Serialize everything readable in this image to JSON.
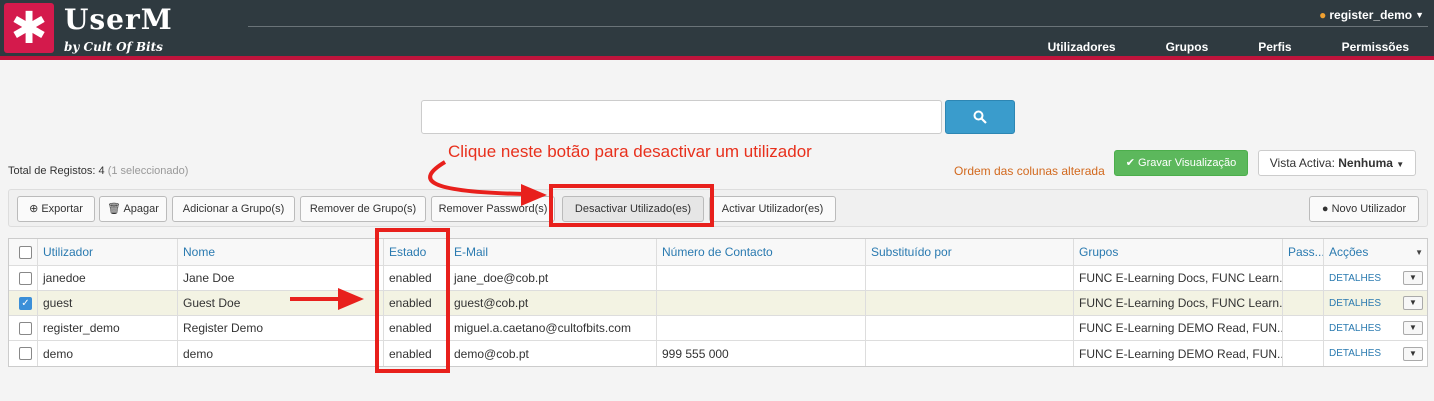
{
  "header": {
    "logo_glyph": "✱",
    "title": "UserM",
    "subtitle": "by Cult Of Bits",
    "user": "register_demo",
    "nav": [
      "Utilizadores",
      "Grupos",
      "Perfis",
      "Permissões"
    ]
  },
  "search": {
    "placeholder": ""
  },
  "summary": {
    "total_label": "Total de Registos:",
    "total_count": "4",
    "selected": "(1 seleccionado)",
    "column_note": "Ordem das colunas alterada",
    "save_view": "Gravar Visualização",
    "active_view_label": "Vista Activa:",
    "active_view_value": "Nenhuma"
  },
  "annotation": "Clique neste botão para desactivar um utilizador",
  "toolbar": {
    "export": "Exportar",
    "delete": "Apagar",
    "add_group": "Adicionar a Grupo(s)",
    "remove_group": "Remover de Grupo(s)",
    "remove_password": "Remover Password(s)",
    "deactivate": "Desactivar Utilizado(es)",
    "activate": "Activar Utilizador(es)",
    "new_user": "Novo Utilizador"
  },
  "table": {
    "headers": [
      "Utilizador",
      "Nome",
      "Estado",
      "E-Mail",
      "Número de Contacto",
      "Substituído por",
      "Grupos",
      "Pass...",
      "Acções"
    ],
    "action_label": "DETALHES",
    "rows": [
      {
        "user": "janedoe",
        "name": "Jane Doe",
        "state": "enabled",
        "email": "jane_doe@cob.pt",
        "phone": "",
        "replaced": "",
        "groups": "FUNC E-Learning Docs, FUNC Learn...",
        "checked": false
      },
      {
        "user": "guest",
        "name": "Guest Doe",
        "state": "enabled",
        "email": "guest@cob.pt",
        "phone": "",
        "replaced": "",
        "groups": "FUNC E-Learning Docs, FUNC Learn...",
        "checked": true
      },
      {
        "user": "register_demo",
        "name": "Register Demo",
        "state": "enabled",
        "email": "miguel.a.caetano@cultofbits.com",
        "phone": "",
        "replaced": "",
        "groups": "FUNC E-Learning DEMO Read, FUN...",
        "checked": false
      },
      {
        "user": "demo",
        "name": "demo",
        "state": "enabled",
        "email": "demo@cob.pt",
        "phone": "999 555 000",
        "replaced": "",
        "groups": "FUNC E-Learning DEMO Read, FUN...",
        "checked": false
      }
    ]
  },
  "colors": {
    "header_bg": "#2f3a40",
    "brand": "#d41a4c",
    "accent": "#3a9ccc",
    "annotation": "#e8301c"
  }
}
